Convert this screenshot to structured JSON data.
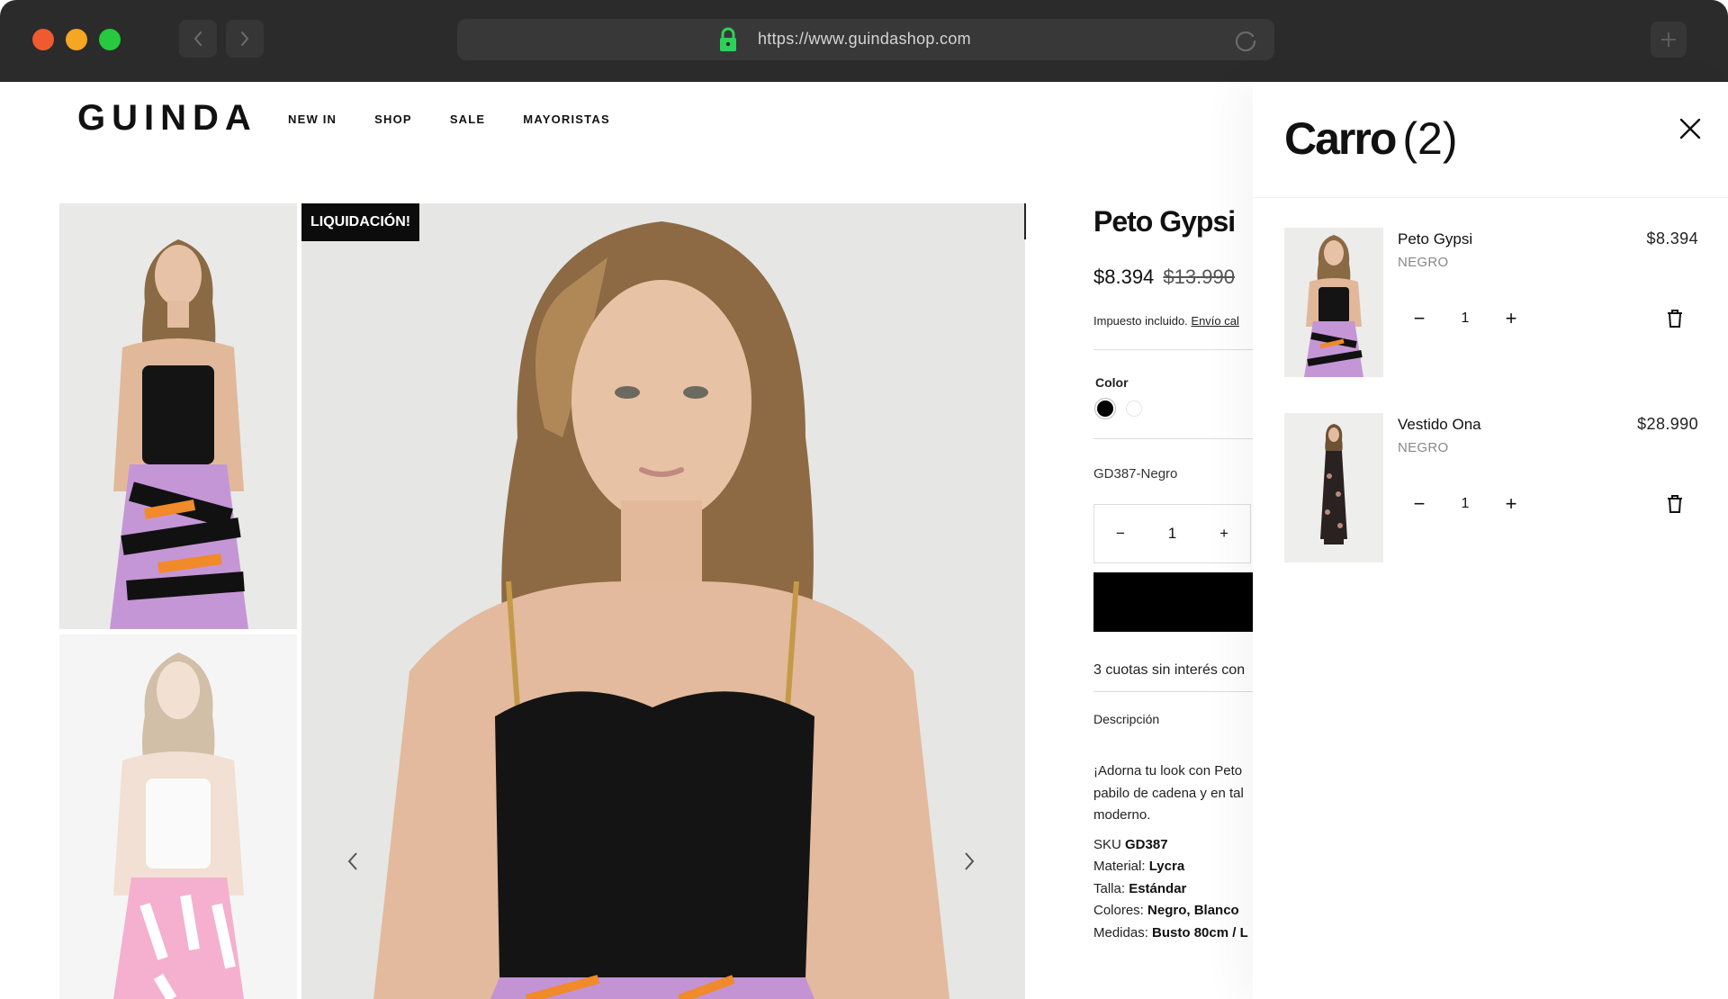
{
  "browser": {
    "url": "https://www.guindashop.com"
  },
  "store": {
    "logo": "GUINDA",
    "nav": [
      "NEW IN",
      "SHOP",
      "SALE",
      "MAYORISTAS"
    ]
  },
  "gallery": {
    "badge": "LIQUIDACIÓN!"
  },
  "product": {
    "title": "Peto Gypsi",
    "price": "$8.394",
    "old_price": "$13.990",
    "tax_text": "Impuesto incluido.",
    "shipping_link": "Envío cal",
    "color_label": "Color",
    "swatches": [
      "black",
      "white"
    ],
    "variant_code": "GD387-Negro",
    "quantity": "1",
    "installments": "3 cuotas sin interés con",
    "description_heading": "Descripción",
    "description_lines": [
      "¡Adorna tu look con Peto",
      "pabilo de cadena y en tal",
      "moderno."
    ],
    "specs": {
      "sku_label": "SKU",
      "sku_value": "GD387",
      "material_label": "Material:",
      "material_value": "Lycra",
      "size_label": "Talla:",
      "size_value": "Estándar",
      "colors_label": "Colores:",
      "colors_value": "Negro, Blanco",
      "measures_label": "Medidas:",
      "measures_value": "Busto 80cm / L"
    }
  },
  "cart": {
    "title": "Carro",
    "count": "(2)",
    "items": [
      {
        "name": "Peto Gypsi",
        "variant": "NEGRO",
        "price": "$8.394",
        "qty": "1"
      },
      {
        "name": "Vestido Ona",
        "variant": "NEGRO",
        "price": "$28.990",
        "qty": "1"
      }
    ]
  },
  "colors": {
    "chrome": "#2b2b2b",
    "traffic_red": "#f05a30",
    "traffic_yellow": "#f5a623",
    "traffic_green": "#27c93f",
    "lock": "#2fd158",
    "badge_bg": "#0c0c0c"
  }
}
